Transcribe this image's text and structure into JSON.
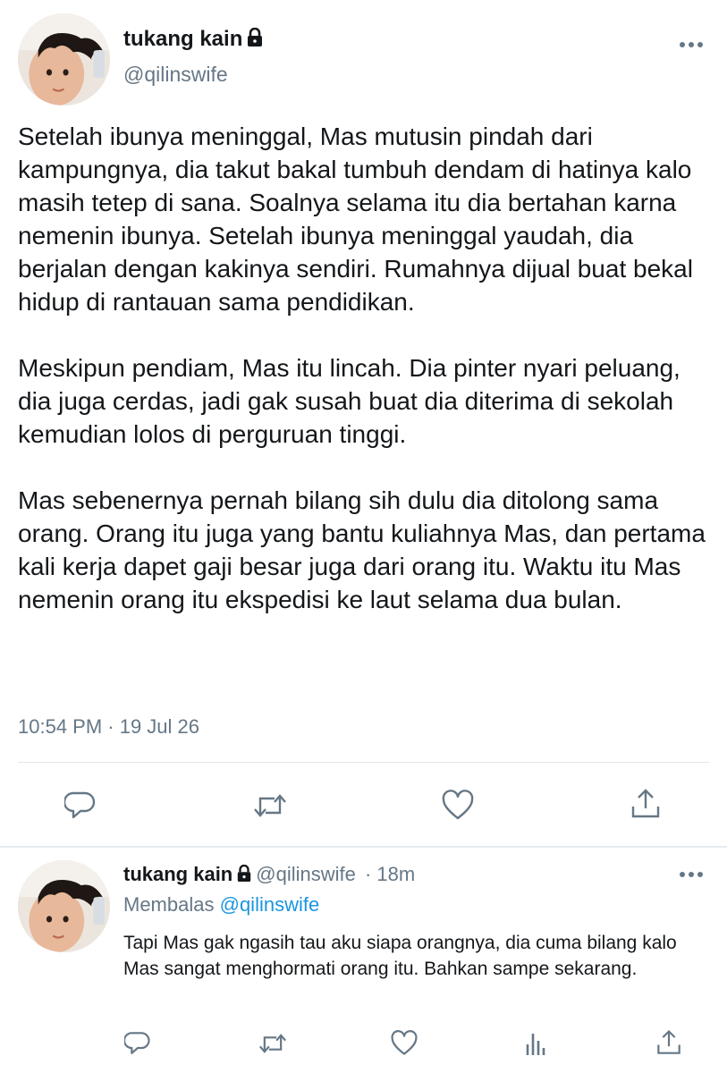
{
  "tweet": {
    "author_name": "tukang kain",
    "author_handle": "@qilinswife",
    "paragraphs": [
      "Setelah ibunya meninggal, Mas mutusin pindah dari kampungnya, dia takut bakal tumbuh dendam di hatinya kalo masih tetep di sana. Soalnya selama itu dia bertahan karna nemenin ibunya. Setelah ibunya meninggal yaudah, dia berjalan dengan kakinya sendiri. Rumahnya dijual buat bekal hidup di rantauan sama pendidikan.",
      "Meskipun pendiam, Mas itu lincah. Dia pinter nyari peluang, dia juga cerdas, jadi gak susah buat dia diterima di sekolah kemudian lolos di perguruan tinggi.",
      "Mas sebenernya pernah bilang sih dulu dia ditolong sama orang. Orang itu juga yang bantu kuliahnya Mas, dan pertama kali kerja dapet gaji besar juga dari orang itu. Waktu itu Mas nemenin orang itu ekspedisi ke laut selama dua bulan."
    ],
    "timestamp": "10:54 PM · 19 Jul 26",
    "actions": [
      "reply-icon",
      "retweet-icon",
      "like-icon",
      "share-icon"
    ]
  },
  "reply": {
    "author_name": "tukang kain",
    "author_handle": "@qilinswife",
    "separator_time": "· 18m",
    "replying_label": "Membalas",
    "replying_to": "@qilinswife",
    "text": "Tapi Mas gak ngasih tau aku siapa orangnya, dia cuma bilang kalo Mas sangat menghormati orang itu. Bahkan sampe sekarang.",
    "actions": [
      "reply-icon",
      "retweet-icon",
      "like-icon",
      "analytics-icon",
      "share-icon"
    ]
  },
  "colors": {
    "text": "#14171a",
    "secondary": "#657786",
    "link": "#1b95e0",
    "divider": "#e1e8ed"
  }
}
